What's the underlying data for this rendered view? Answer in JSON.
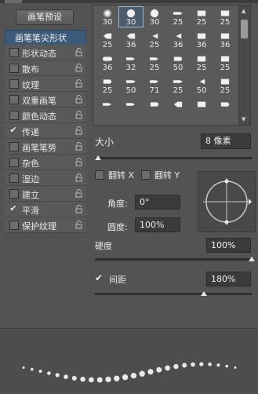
{
  "left_panel": {
    "preset_button": "画笔预设",
    "header_item": "画笔笔尖形状",
    "options": [
      {
        "label": "形状动态",
        "checked": false
      },
      {
        "label": "散布",
        "checked": false
      },
      {
        "label": "纹理",
        "checked": false
      },
      {
        "label": "双重画笔",
        "checked": false
      },
      {
        "label": "颜色动态",
        "checked": false
      },
      {
        "label": "传递",
        "checked": true
      },
      {
        "label": "画笔笔势",
        "checked": false
      },
      {
        "label": "杂色",
        "checked": false
      },
      {
        "label": "湿边",
        "checked": false
      },
      {
        "label": "建立",
        "checked": false
      },
      {
        "label": "平滑",
        "checked": true
      },
      {
        "label": "保护纹理",
        "checked": false
      }
    ]
  },
  "brush_grid": {
    "rows": [
      {
        "glyphs": [
          "soft-dot",
          "hard-dot",
          "hard-dot",
          "arrow-brush",
          "flat-brush",
          "flat-brush"
        ],
        "sizes": [
          "30",
          "30",
          "30",
          "25",
          "25",
          "25"
        ]
      },
      {
        "glyphs": [
          "blade-brush",
          "blade-brush",
          "fan-brush",
          "fan-brush",
          "flat-brush",
          "flat-brush"
        ],
        "sizes": [
          "25",
          "36",
          "25",
          "36",
          "36",
          "36"
        ]
      },
      {
        "glyphs": [
          "round-brush",
          "tip-brush",
          "tip-brush",
          "cap-brush",
          "flat-brush",
          "flat-brush"
        ],
        "sizes": [
          "36",
          "32",
          "25",
          "50",
          "25",
          "25"
        ]
      },
      {
        "glyphs": [
          "cap-brush",
          "arrow-brush",
          "tip-brush",
          "arrow-brush",
          "fan-brush",
          "flat-brush"
        ],
        "sizes": [
          "25",
          "50",
          "71",
          "25",
          "50",
          "25"
        ]
      },
      {
        "glyphs": [
          "tip-brush",
          "tip-brush",
          "cap-brush",
          "blade-brush",
          "flat-brush",
          "cap-brush"
        ],
        "sizes": [
          "",
          "",
          "",
          "",
          "",
          ""
        ]
      }
    ],
    "selected_index": 1
  },
  "size": {
    "label": "大小",
    "value": "8 像素"
  },
  "flip": {
    "x_label": "翻转 X",
    "y_label": "翻转 Y",
    "x_checked": false,
    "y_checked": false
  },
  "angle": {
    "label": "角度:",
    "value": "0°"
  },
  "roundness": {
    "label": "圆度:",
    "value": "100%"
  },
  "hardness": {
    "label": "硬度",
    "value": "100%",
    "fraction": 1.0
  },
  "spacing": {
    "label": "间距",
    "value": "180%",
    "checked": true
  },
  "colors": {
    "header_blue": "#3d5a7a",
    "panel": "#535353"
  }
}
